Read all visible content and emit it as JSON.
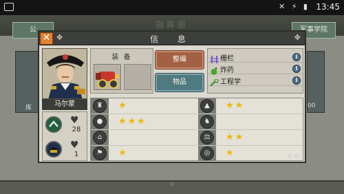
{
  "status_bar": {
    "time": "13:45"
  },
  "background": {
    "title": "指挥部",
    "left_button": "公",
    "right_button": "军事学院",
    "left_card_label": "库",
    "right_card_label": "00"
  },
  "dialog": {
    "title": "信 息",
    "close_glyph": "✕",
    "general": {
      "name": "马尔蒙"
    },
    "equipment": {
      "label": "装 备"
    },
    "buttons": {
      "organize": "整编",
      "items": "物品"
    },
    "techs": [
      {
        "name": "栅栏",
        "icon": "fence-icon",
        "color": "#9a7fd6"
      },
      {
        "name": "炸药",
        "icon": "bomb-icon",
        "color": "#4aa52c"
      },
      {
        "name": "工程学",
        "icon": "wrench-icon",
        "color": "#3f9a33"
      }
    ],
    "info_glyph": "i",
    "stats": [
      {
        "value": "28",
        "icon": "cavalry-badge-icon"
      },
      {
        "value": "1",
        "icon": "infantry-badge-icon"
      }
    ],
    "attributes": [
      {
        "left_icon": "infantry-icon",
        "left_stars": 1,
        "right_icon": "cavalry-icon",
        "right_stars": 2
      },
      {
        "left_icon": "cannon-icon",
        "left_stars": 3,
        "right_icon": "horse-icon",
        "right_stars": 0
      },
      {
        "left_icon": "camp-icon",
        "left_stars": 0,
        "right_icon": "scales-icon",
        "right_stars": 2
      },
      {
        "left_icon": "flag-icon",
        "left_stars": 1,
        "right_icon": "target-icon",
        "right_stars": 1
      }
    ],
    "star_color": "#e9b80d"
  }
}
